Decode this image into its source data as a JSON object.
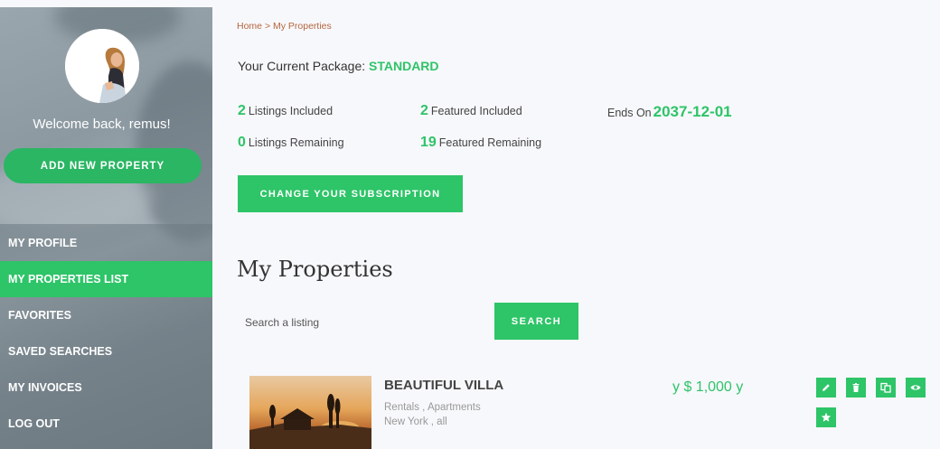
{
  "sidebar": {
    "welcome": "Welcome back, remus!",
    "add_button": "ADD NEW PROPERTY",
    "nav": [
      {
        "label": "MY PROFILE"
      },
      {
        "label": "MY PROPERTIES LIST"
      },
      {
        "label": "FAVORITES"
      },
      {
        "label": "SAVED SEARCHES"
      },
      {
        "label": "MY INVOICES"
      },
      {
        "label": "LOG OUT"
      }
    ],
    "active_item": "MY PROPERTIES LIST"
  },
  "breadcrumb": {
    "home": "Home",
    "separator": ">",
    "current": "My Properties"
  },
  "package": {
    "label": "Your Current Package:",
    "name": "STANDARD",
    "listings_included": {
      "value": "2",
      "label": "Listings Included"
    },
    "featured_included": {
      "value": "2",
      "label": "Featured Included"
    },
    "listings_remaining": {
      "value": "0",
      "label": "Listings Remaining"
    },
    "featured_remaining": {
      "value": "19",
      "label": "Featured Remaining"
    },
    "ends_label": "Ends On",
    "ends_date": "2037-12-01",
    "change_button": "CHANGE YOUR SUBSCRIPTION"
  },
  "properties": {
    "title": "My Properties",
    "search_placeholder": "Search a listing",
    "search_button": "SEARCH",
    "items": [
      {
        "title": "BEAUTIFUL VILLA",
        "categories": "Rentals , Apartments",
        "location": "New York , all",
        "price": "y $ 1,000 y",
        "actions": [
          "edit-icon",
          "delete-icon",
          "duplicate-icon",
          "view-icon",
          "featured-star-icon"
        ]
      }
    ]
  },
  "colors": {
    "accent": "#2ec468",
    "breadcrumb": "#b5663f"
  }
}
